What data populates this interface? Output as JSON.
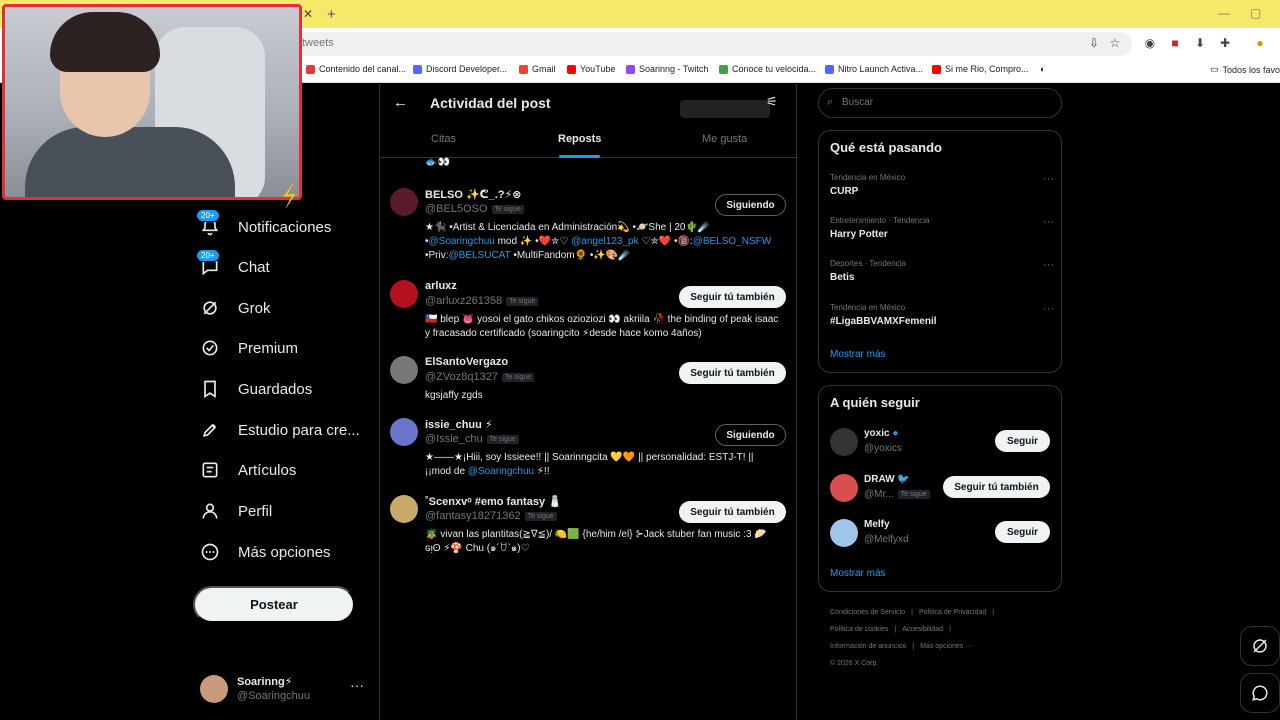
{
  "browser": {
    "url_text": "tweets",
    "bookmarks": [
      {
        "label": "Contenido del canal...",
        "color": "#e53935"
      },
      {
        "label": "Discord Developer...",
        "color": "#5865f2"
      },
      {
        "label": "Gmail",
        "color": "#ea4335"
      },
      {
        "label": "YouTube",
        "color": "#ff0000"
      },
      {
        "label": "Soarinng - Twitch",
        "color": "#9146ff"
      },
      {
        "label": "Conoce tu velocida...",
        "color": "#43a047"
      },
      {
        "label": "Nitro Launch Activa...",
        "color": "#5865f2"
      },
      {
        "label": "Si me Rio, Compro...",
        "color": "#ff0000"
      }
    ],
    "all_bookmarks": "Todos los favor"
  },
  "nav": {
    "items": [
      {
        "label": "Notificaciones",
        "icon": "bell-icon",
        "badge": "20+"
      },
      {
        "label": "Chat",
        "icon": "chat-icon",
        "badge": "20+"
      },
      {
        "label": "Grok",
        "icon": "grok-icon",
        "badge": ""
      },
      {
        "label": "Premium",
        "icon": "premium-icon",
        "badge": ""
      },
      {
        "label": "Guardados",
        "icon": "bookmark-icon",
        "badge": ""
      },
      {
        "label": "Estudio para cre...",
        "icon": "rocket-icon",
        "badge": ""
      },
      {
        "label": "Artículos",
        "icon": "article-icon",
        "badge": ""
      },
      {
        "label": "Perfil",
        "icon": "person-icon",
        "badge": ""
      },
      {
        "label": "Más opciones",
        "icon": "more-icon",
        "badge": ""
      }
    ],
    "post_button": "Postear"
  },
  "account": {
    "name": "Soarinng⚡",
    "handle": "@Soaringchuu"
  },
  "main": {
    "title": "Actividad del post",
    "tabs": [
      "Citas",
      "Reposts",
      "Me gusta"
    ],
    "active_tab": 1,
    "top_fragment": "🐟👀",
    "users": [
      {
        "name": "BELSO ✨ᕦ_.?⚡⊗",
        "handle": "@BEL5OSO",
        "badge": "Te sigue",
        "follow": "Siguiendo",
        "following": true,
        "avatar_color": "#5a1b2a",
        "bio_parts": [
          {
            "t": "★🐈‍⬛ •Artist & Licenciada en Administración💫 •🪐She | 20🌵☄️ •",
            "link": false
          },
          {
            "t": "@Soaringchuu",
            "link": true
          },
          {
            "t": " mod ✨ •❤️✮♡ ",
            "link": false
          },
          {
            "t": "@angel123_pk",
            "link": true
          },
          {
            "t": " ♡✮❤️ •🔞:",
            "link": false
          },
          {
            "t": "@BELSO_NSFW",
            "link": true
          },
          {
            "t": " •Priv:",
            "link": false
          },
          {
            "t": "@BELSUCAT",
            "link": true
          },
          {
            "t": " •MultiFandom🌻 •✨🎨☄️",
            "link": false
          }
        ]
      },
      {
        "name": "arluxz",
        "handle": "@arluxz261358",
        "badge": "Te sigue",
        "follow": "Seguir tú también",
        "following": false,
        "avatar_color": "#b3111d",
        "bio_parts": [
          {
            "t": "🇨🇱 blep 👅 yosoi el gato chikos ozioziozi 👀 akriila 🥀 the binding of peak isaac y fracasado certificado (soaringcito ⚡desde hace komo 4años)",
            "link": false
          }
        ]
      },
      {
        "name": "ElSantoVergazo",
        "handle": "@ZVoz8q1327",
        "badge": "Te sigue",
        "follow": "Seguir tú también",
        "following": false,
        "avatar_color": "#777777",
        "bio_parts": [
          {
            "t": "kgsjaffy zgds",
            "link": false
          }
        ]
      },
      {
        "name": "issie_chuu ⚡",
        "handle": "@Issie_chu",
        "badge": "Te sigue",
        "follow": "Siguiendo",
        "following": true,
        "avatar_color": "#6a74c9",
        "bio_parts": [
          {
            "t": "★——★¡Hiii, soy Issieee!! || Soarinngcita 💛🧡 || personalidad: ESTJ-T! || ¡¡mod de ",
            "link": false
          },
          {
            "t": "@Soaringchuu",
            "link": true
          },
          {
            "t": " ⚡!!",
            "link": false
          }
        ]
      },
      {
        "name": "˚Scenxvᵒ #emo fantasy 🧂",
        "handle": "@fantasy18271362",
        "badge": "Te sigue",
        "follow": "Seguir tú también",
        "following": false,
        "avatar_color": "#c9a96a",
        "bio_parts": [
          {
            "t": "🪴 vivan las plantitas(≧∇≦)/ 🍋🟩 {he/him /el} ⊱Jack stuber fan music :3 🥟 ɢᴉʘ ⚡🍄 Chu (๑´ꇴ`๑)♡",
            "link": false
          }
        ]
      }
    ]
  },
  "sidebar": {
    "search_placeholder": "Buscar",
    "trends_title": "Qué está pasando",
    "trends": [
      {
        "meta": "Tendencia en México",
        "title": "CURP"
      },
      {
        "meta": "Entretenimiento · Tendencia",
        "title": "Harry Potter"
      },
      {
        "meta": "Deportes · Tendencia",
        "title": "Betis"
      },
      {
        "meta": "Tendencia en México",
        "title": "#LigaBBVAMXFemenil"
      }
    ],
    "show_more": "Mostrar más",
    "who_title": "A quién seguir",
    "who": [
      {
        "name": "yoxic",
        "handle": "@yoxics",
        "badge": "",
        "button": "Seguir",
        "color": "#333333"
      },
      {
        "name": "DRAW 🐦",
        "handle": "@Mr...",
        "badge": "Te sigue",
        "button": "Seguir tú también",
        "color": "#d94f4f"
      },
      {
        "name": "Melfy",
        "handle": "@Melfyxd",
        "badge": "",
        "button": "Seguir",
        "color": "#9fc5e8"
      }
    ],
    "who_show_more": "Mostrar más",
    "footer_lines": [
      [
        "Condiciones de Servicio",
        "|",
        "Política de Privacidad",
        "|"
      ],
      [
        "Política de cookies",
        "|",
        "Accesibilidad",
        "|"
      ],
      [
        "Información de anuncios",
        "|",
        "Más opciones ···"
      ],
      [
        "© 2026 X Corp."
      ]
    ]
  },
  "colors": {
    "accent": "#1d9bf0",
    "border": "#2f3336",
    "muted": "#71767b",
    "chrome": "#f6e96a"
  }
}
